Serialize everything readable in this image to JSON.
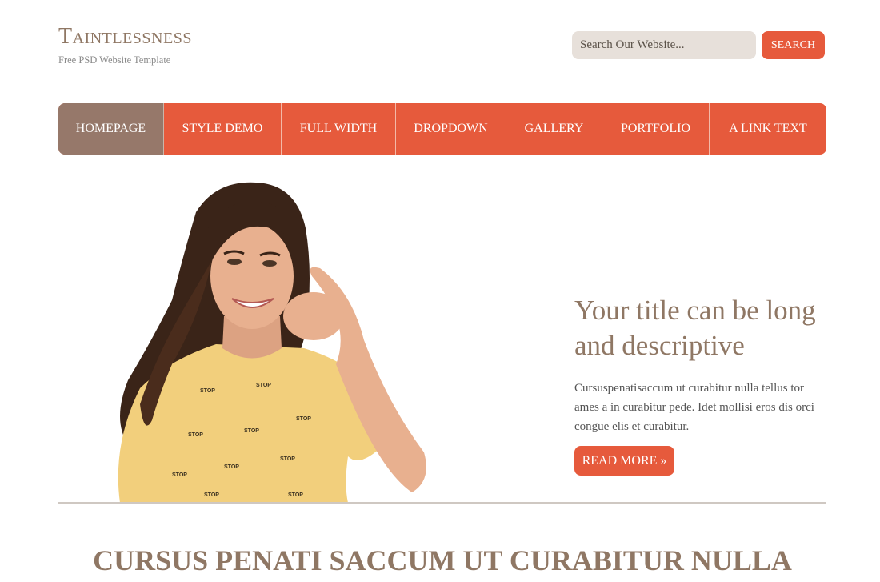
{
  "brand": {
    "title": "Taintlessness",
    "tagline": "Free PSD Website Template"
  },
  "search": {
    "placeholder": "Search Our Website...",
    "button_label": "SEARCH"
  },
  "nav": {
    "items": [
      {
        "label": "HOMEPAGE",
        "active": true
      },
      {
        "label": "STYLE DEMO",
        "active": false
      },
      {
        "label": "FULL WIDTH",
        "active": false
      },
      {
        "label": "DROPDOWN",
        "active": false
      },
      {
        "label": "GALLERY",
        "active": false
      },
      {
        "label": "PORTFOLIO",
        "active": false
      },
      {
        "label": "A LINK TEXT",
        "active": false
      }
    ]
  },
  "hero": {
    "title": "Your title can be long and descriptive",
    "text": "Cursuspenatisaccum ut curabitur nulla tellus tor ames a in curabitur pede. Idet mollisi eros dis orci congue elis et curabitur.",
    "button_label": "READ MORE »",
    "image_label": "STOP"
  },
  "section": {
    "heading": "CURSUS PENATI SACCUM UT CURABITUR NULLA"
  },
  "colors": {
    "accent": "#e65a3c",
    "brand": "#8f7764",
    "nav_active": "#96786a",
    "search_bg": "#e7e0da",
    "shirt": "#f2cf7c",
    "hair": "#3a2418",
    "skin": "#e8b08f"
  }
}
